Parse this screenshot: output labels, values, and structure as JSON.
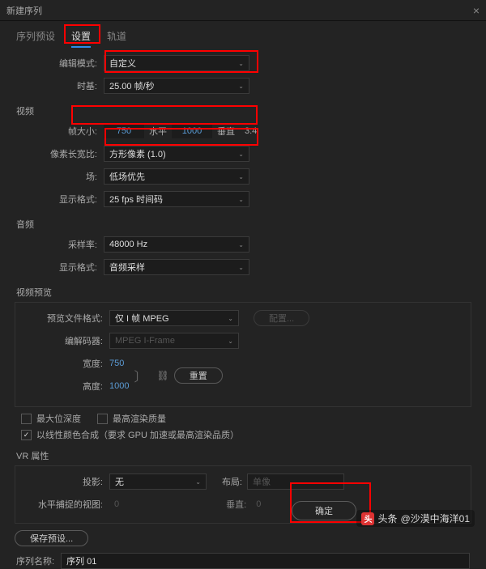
{
  "window": {
    "title": "新建序列"
  },
  "tabs": {
    "preset": "序列预设",
    "settings": "设置",
    "tracks": "轨道"
  },
  "edit": {
    "mode_label": "编辑模式:",
    "mode_value": "自定义",
    "timebase_label": "时基:",
    "timebase_value": "25.00 帧/秒"
  },
  "video": {
    "section": "视频",
    "framesize_label": "帧大小:",
    "width": "750",
    "h_label": "水平",
    "height": "1000",
    "v_label": "垂直",
    "ratio": "3:4",
    "par_label": "像素长宽比:",
    "par_value": "方形像素 (1.0)",
    "fields_label": "场:",
    "fields_value": "低场优先",
    "display_label": "显示格式:",
    "display_value": "25 fps 时间码"
  },
  "audio": {
    "section": "音频",
    "rate_label": "采样率:",
    "rate_value": "48000 Hz",
    "display_label": "显示格式:",
    "display_value": "音频采样"
  },
  "preview": {
    "section": "视频预览",
    "format_label": "预览文件格式:",
    "format_value": "仅 I 帧 MPEG",
    "config_btn": "配置...",
    "codec_label": "编解码器:",
    "codec_value": "MPEG I-Frame",
    "width_label": "宽度:",
    "width_value": "750",
    "height_label": "高度:",
    "height_value": "1000",
    "reset_btn": "重置"
  },
  "cb": {
    "maxdepth": "最大位深度",
    "maxquality": "最高渲染质量",
    "linear": "以线性颜色合成（要求 GPU 加速或最高渲染品质）"
  },
  "vr": {
    "section": "VR 属性",
    "proj_label": "投影:",
    "proj_value": "无",
    "layout_label": "布局:",
    "layout_value": "单像",
    "hfov_label": "水平捕捉的视图:",
    "hfov_value": "0",
    "vfov_label": "垂直:",
    "vfov_value": "0"
  },
  "save_preset": "保存预设...",
  "seq": {
    "label": "序列名称:",
    "value": "序列 01"
  },
  "footer": {
    "ok": "确定"
  },
  "wm": {
    "prefix": "头条",
    "author": "@沙漠中海洋01"
  }
}
